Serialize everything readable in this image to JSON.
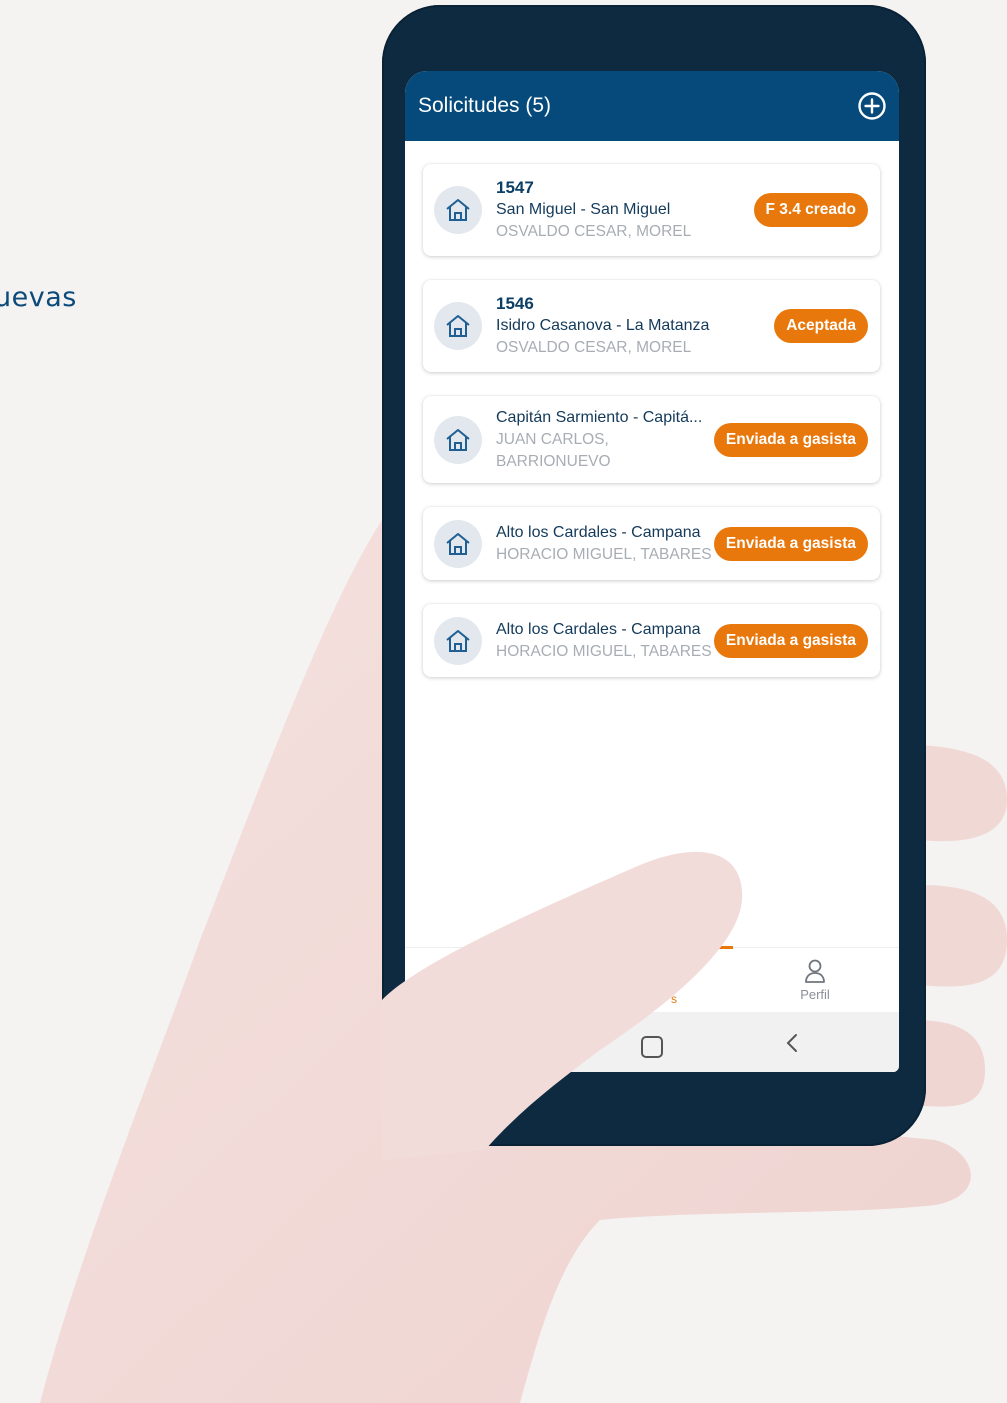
{
  "side_text": "uevas",
  "appbar": {
    "title": "Solicitudes (5)",
    "add_icon": "plus-circle-icon"
  },
  "requests": [
    {
      "number": "1547",
      "location": "San Miguel - San Miguel",
      "person": "OSVALDO CESAR, MOREL",
      "status": "F 3.4 creado"
    },
    {
      "number": "1546",
      "location": "Isidro Casanova - La Matanza",
      "person": "OSVALDO CESAR, MOREL",
      "status": "Aceptada"
    },
    {
      "number": "",
      "location": "Capitán Sarmiento - Capitá...",
      "person": "JUAN CARLOS,\nBARRIONUEVO",
      "person_line1": "JUAN CARLOS,",
      "person_line2": "BARRIONUEVO",
      "status": "Enviada a gasista"
    },
    {
      "number": "",
      "location": "Alto los Cardales - Campana",
      "person": "HORACIO MIGUEL, TABARES",
      "status": "Enviada a gasista"
    },
    {
      "number": "",
      "location": "Alto los Cardales - Campana",
      "person": "HORACIO MIGUEL, TABARES",
      "status": "Enviada a gasista"
    }
  ],
  "bottom_nav": {
    "active_partial_label": "s",
    "profile_label": "Perfil"
  },
  "colors": {
    "primary": "#054a7a",
    "accent": "#e8780c",
    "phone": "#0e2a41",
    "skin": "#f2dcd9"
  }
}
